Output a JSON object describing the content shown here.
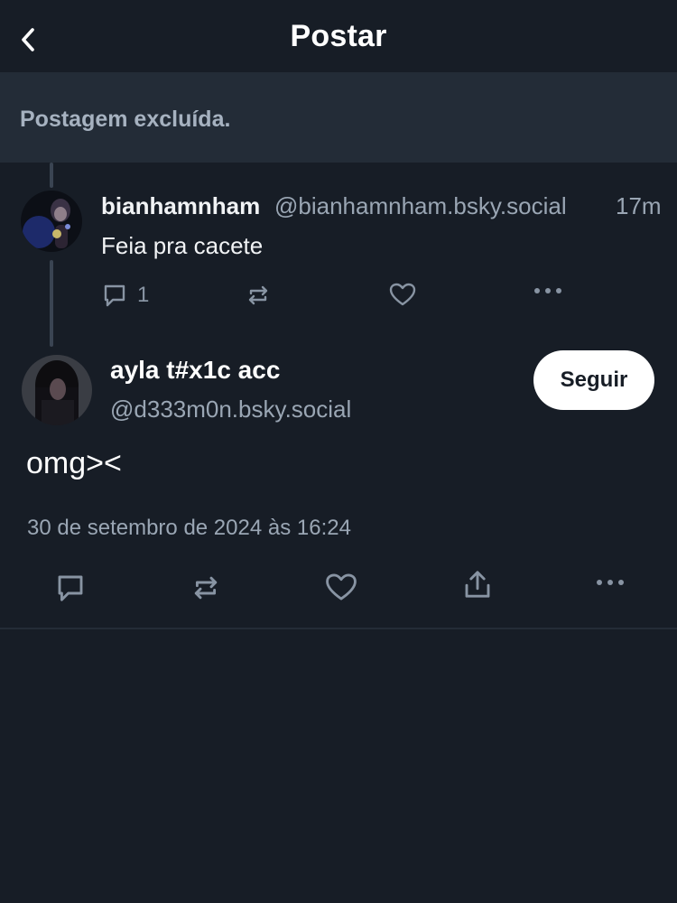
{
  "header": {
    "title": "Postar",
    "back_icon": "chevron-left-icon"
  },
  "deleted_notice": "Postagem excluída.",
  "reply_post": {
    "author_name": "bianhamnham",
    "author_handle": "@bianhamnham.bsky.social",
    "time": "17m",
    "text": "Feia pra cacete",
    "reply_count": "1",
    "icons": [
      "comment-icon",
      "repost-icon",
      "heart-icon",
      "more-icon"
    ]
  },
  "main_post": {
    "author_name": "ayla t#x1c acc",
    "author_handle": "@d333m0n.bsky.social",
    "follow_label": "Seguir",
    "text": "omg><",
    "date": "30 de setembro de 2024 às 16:24",
    "icons": [
      "comment-icon",
      "repost-icon",
      "heart-icon",
      "share-icon",
      "more-icon"
    ]
  },
  "colors": {
    "background": "#171d26",
    "banner": "#232c37",
    "muted_text": "#9aa6b4",
    "icon": "#8894a3",
    "follow_button": "#ffffff"
  }
}
